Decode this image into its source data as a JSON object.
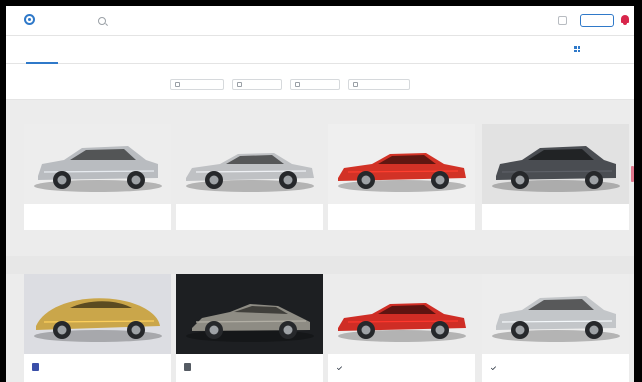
{
  "header": {
    "app_name": "",
    "search_placeholder": "",
    "action_label": ""
  },
  "tabs": [
    {
      "label": "",
      "active": true
    },
    {
      "label": "",
      "active": false
    },
    {
      "label": "",
      "active": false
    },
    {
      "label": "",
      "active": false
    }
  ],
  "view_toggle_label": "",
  "filters": {
    "groups": [
      {
        "label": "",
        "value": ""
      },
      {
        "label": "",
        "value": ""
      },
      {
        "label": "",
        "value": ""
      }
    ],
    "chips": [
      "",
      "",
      "",
      ""
    ],
    "right_group": {
      "label": "",
      "value": ""
    }
  },
  "section": {
    "title": "",
    "link": ""
  },
  "featured_cars": [
    {
      "name": "",
      "price": "",
      "color": "#b9bcc0",
      "body": "suv",
      "backdrop": "#ededed"
    },
    {
      "name": "",
      "price": "",
      "color": "#bfc1c4",
      "body": "sedan",
      "backdrop": "#ececec"
    },
    {
      "name": "",
      "price": "",
      "color": "#d23226",
      "body": "sedan",
      "backdrop": "#efefef"
    },
    {
      "name": "",
      "price": "",
      "color": "#4a4d52",
      "body": "suv",
      "backdrop": "#e2e2e2"
    }
  ],
  "more_cars": [
    {
      "name": "",
      "stat": "",
      "color": "#caa64a",
      "body": "concept",
      "backdrop": "#dcdde2",
      "maker_icon": "logo-badge-icon"
    },
    {
      "name": "",
      "stat": "",
      "color": "#8e8c84",
      "body": "coupe",
      "backdrop": "#1d1f22",
      "maker_icon": "logo-badge-icon"
    },
    {
      "name": "",
      "stat": "",
      "color": "#cf2d25",
      "body": "sedan",
      "backdrop": "#ececec",
      "maker_icon": "check-icon"
    },
    {
      "name": "",
      "stat": "",
      "color": "#c3c6c9",
      "body": "suv",
      "backdrop": "#ededed",
      "maker_icon": "check-icon"
    }
  ],
  "colors": {
    "accent": "#2f79c9",
    "price": "#d8264b"
  }
}
